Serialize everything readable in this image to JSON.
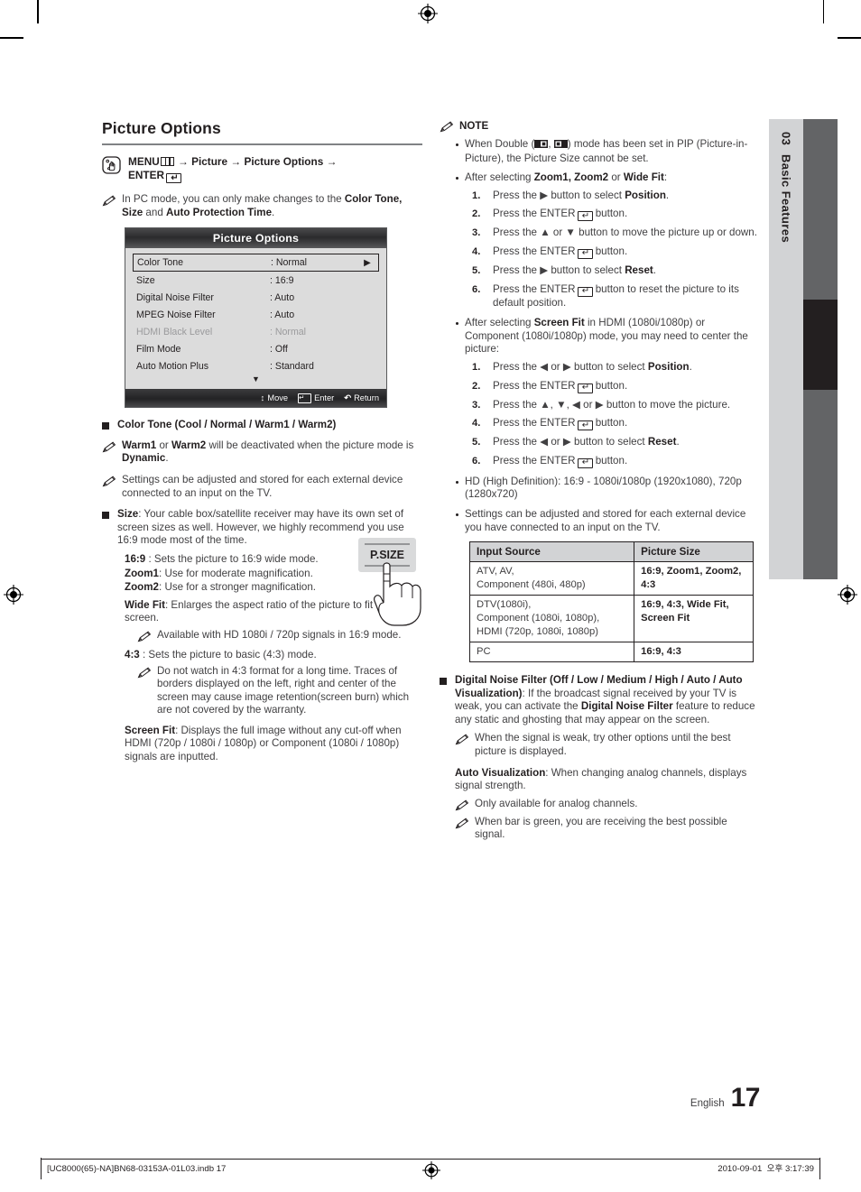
{
  "page": {
    "title": "Picture Options",
    "language": "English",
    "number": "17",
    "chapter_num": "03",
    "chapter_name": "Basic Features"
  },
  "menu_path": {
    "prefix": "MENU",
    "menu_icon": "menu-grid-icon",
    "arrow": "→",
    "step1": "Picture",
    "step2": "Picture Options",
    "enter_label": "ENTER",
    "enter_icon": "enter-key-icon",
    "hand_icon": "pointing-hand-icon"
  },
  "left": {
    "pc_note": {
      "icon": "pencil-note-icon",
      "text_1": "In PC mode, you can only make changes to the ",
      "bold_1": "Color Tone, Size",
      "text_2": " and ",
      "bold_2": "Auto Protection Time",
      "text_3": "."
    },
    "osd": {
      "title": "Picture Options",
      "rows": [
        {
          "label": "Color Tone",
          "value": ": Normal",
          "selected": true,
          "arrow": "▶",
          "dim": false
        },
        {
          "label": "Size",
          "value": ": 16:9",
          "selected": false,
          "arrow": "",
          "dim": false
        },
        {
          "label": "Digital Noise Filter",
          "value": ": Auto",
          "selected": false,
          "arrow": "",
          "dim": false
        },
        {
          "label": "MPEG Noise Filter",
          "value": ": Auto",
          "selected": false,
          "arrow": "",
          "dim": false
        },
        {
          "label": "HDMI Black Level",
          "value": ": Normal",
          "selected": false,
          "arrow": "",
          "dim": true
        },
        {
          "label": "Film Mode",
          "value": ": Off",
          "selected": false,
          "arrow": "",
          "dim": false
        },
        {
          "label": "Auto Motion Plus",
          "value": ": Standard",
          "selected": false,
          "arrow": "",
          "dim": false
        }
      ],
      "scroll_down": "▼",
      "footer": {
        "move_icon": "↕",
        "move": "Move",
        "enter_icon": "enter-key-icon",
        "enter": "Enter",
        "return_icon": "↶",
        "return": "Return"
      }
    },
    "color_tone_heading": "Color Tone (Cool / Normal / Warm1 / Warm2)",
    "note_warm": {
      "bold_1": "Warm1",
      "mid_1": " or ",
      "bold_2": "Warm2",
      "mid_2": " will be deactivated when the picture mode is ",
      "bold_3": "Dynamic",
      "end": "."
    },
    "note_settings": "Settings can be adjusted and stored for each external device connected to an input on the TV.",
    "size_heading_bold": "Size",
    "size_heading_rest": ": Your cable box/satellite receiver may have its own set of screen sizes as well. However, we highly recommend you use 16:9 mode most of the time.",
    "psize_button_label": "P.SIZE",
    "psize_icon": "remote-psize-button-illustration",
    "modes": [
      {
        "name": "16:9",
        "sep": " : ",
        "desc": "Sets the picture to 16:9 wide mode."
      },
      {
        "name": "Zoom1",
        "sep": ": ",
        "desc": "Use for moderate magnification."
      },
      {
        "name": "Zoom2",
        "sep": ": ",
        "desc": "Use for a stronger magnification."
      }
    ],
    "wide_fit": {
      "name": "Wide Fit",
      "desc": ": Enlarges the aspect ratio of the picture to fit the entire screen.",
      "note": "Available with HD 1080i / 720p signals in 16:9 mode."
    },
    "four_three": {
      "name": "4:3",
      "desc": " : Sets the picture to basic (4:3) mode.",
      "note": "Do not watch in 4:3 format for a long time. Traces of borders displayed on the left, right and center of the screen may cause image retention(screen burn) which are not covered by the warranty."
    },
    "screen_fit": {
      "name": "Screen Fit",
      "desc": ": Displays the full image without any cut-off when HDMI (720p / 1080i / 1080p) or Component (1080i / 1080p) signals are inputted."
    }
  },
  "right": {
    "note_title": "NOTE",
    "note_icon": "pencil-note-icon",
    "bullets": [
      {
        "type": "text",
        "parts": [
          {
            "t": "When Double ("
          },
          {
            "icon": "pip-double-left-icon"
          },
          {
            "t": ", "
          },
          {
            "icon": "pip-double-right-icon"
          },
          {
            "t": ") mode has been set in PIP (Picture-in-Picture), the Picture Size cannot be set."
          }
        ]
      },
      {
        "type": "steps",
        "lead_plain_1": "After selecting ",
        "lead_bold_1": "Zoom1, Zoom2",
        "lead_plain_2": " or ",
        "lead_bold_2": "Wide Fit",
        "lead_plain_3": ":",
        "steps": [
          {
            "n": "1.",
            "plain_1": "Press the ▶ button to select ",
            "bold": "Position",
            "plain_2": "."
          },
          {
            "n": "2.",
            "plain_1": "Press the ENTER",
            "enter": true,
            "plain_2": " button."
          },
          {
            "n": "3.",
            "plain_1": "Press the ▲ or ▼ button to move the picture up or down.",
            "plain_2": ""
          },
          {
            "n": "4.",
            "plain_1": "Press the ENTER",
            "enter": true,
            "plain_2": " button."
          },
          {
            "n": "5.",
            "plain_1": "Press the ▶ button to select ",
            "bold": "Reset",
            "plain_2": "."
          },
          {
            "n": "6.",
            "plain_1": "Press the ENTER",
            "enter": true,
            "plain_2": " button to reset the picture to its default position."
          }
        ]
      },
      {
        "type": "steps",
        "lead_plain_1": "After selecting ",
        "lead_bold_1": "Screen Fit",
        "lead_plain_2": " in HDMI (1080i/1080p) or Component (1080i/1080p) mode, you may need to center the picture:",
        "lead_bold_2": "",
        "lead_plain_3": "",
        "steps": [
          {
            "n": "1.",
            "plain_1": "Press the ◀ or ▶ button to select ",
            "bold": "Position",
            "plain_2": "."
          },
          {
            "n": "2.",
            "plain_1": "Press the ENTER",
            "enter": true,
            "plain_2": " button."
          },
          {
            "n": "3.",
            "plain_1": "Press the ▲, ▼, ◀ or ▶ button to move the picture.",
            "plain_2": ""
          },
          {
            "n": "4.",
            "plain_1": "Press the ENTER",
            "enter": true,
            "plain_2": " button."
          },
          {
            "n": "5.",
            "plain_1": "Press the ◀ or ▶ button to select ",
            "bold": "Reset",
            "plain_2": "."
          },
          {
            "n": "6.",
            "plain_1": "Press the ENTER",
            "enter": true,
            "plain_2": " button."
          }
        ]
      },
      {
        "type": "text",
        "plain": "HD (High Definition): 16:9 - 1080i/1080p (1920x1080), 720p (1280x720)"
      },
      {
        "type": "text",
        "plain": "Settings can be adjusted and stored for each external device you have connected to an input on the TV."
      }
    ],
    "table": {
      "headers": [
        "Input Source",
        "Picture Size"
      ],
      "rows": [
        {
          "source": "ATV, AV,\nComponent (480i, 480p)",
          "size": "16:9, Zoom1, Zoom2, 4:3"
        },
        {
          "source": "DTV(1080i),\nComponent (1080i, 1080p),\nHDMI (720p, 1080i, 1080p)",
          "size": "16:9, 4:3, Wide Fit, Screen Fit"
        },
        {
          "source": "PC",
          "size": "16:9, 4:3"
        }
      ]
    },
    "dnf": {
      "bold_1": "Digital Noise Filter (Off / Low / Medium / High / Auto / Auto Visualization)",
      "plain_1": ": If the broadcast signal received by your TV is weak, you can activate the ",
      "bold_2": "Digital Noise Filter",
      "plain_2": " feature to reduce any static and ghosting that may appear on the screen.",
      "note": "When the signal is weak, try other options until the best picture is displayed."
    },
    "auto_vis": {
      "bold": "Auto Visualization",
      "plain": ": When changing analog channels, displays signal strength.",
      "note_1": "Only available for analog channels.",
      "note_2": "When bar is green, you are receiving the best possible signal."
    }
  },
  "footer": {
    "left": "[UC8000(65)-NA]BN68-03153A-01L03.indb   17",
    "right_date": "2010-09-01",
    "right_time": "오후 3:17:39",
    "center_icon": "registration-target-icon"
  }
}
